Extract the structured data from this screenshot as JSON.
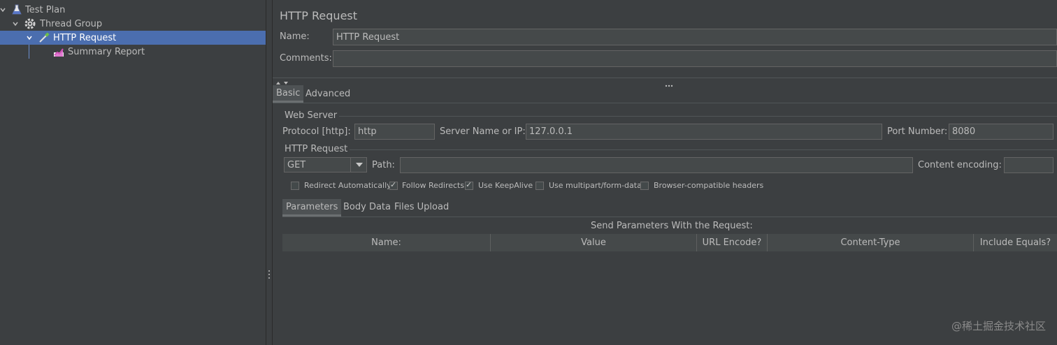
{
  "tree": {
    "items": [
      {
        "label": "Test Plan",
        "icon": "test-plan-flask-icon"
      },
      {
        "label": "Thread Group",
        "icon": "thread-group-gear-icon"
      },
      {
        "label": "HTTP Request",
        "icon": "http-request-pipette-icon",
        "selected": true
      },
      {
        "label": "Summary Report",
        "icon": "summary-report-chart-icon"
      }
    ]
  },
  "panel": {
    "title": "HTTP Request",
    "name_label": "Name:",
    "name_value": "HTTP Request",
    "comments_label": "Comments:",
    "comments_value": ""
  },
  "tabs": {
    "basic": "Basic",
    "advanced": "Advanced"
  },
  "web_server": {
    "section": "Web Server",
    "protocol_label": "Protocol [http]:",
    "protocol_value": "http",
    "server_label": "Server Name or IP:",
    "server_value": "127.0.0.1",
    "port_label": "Port Number:",
    "port_value": "8080"
  },
  "http_request": {
    "section": "HTTP Request",
    "method": "GET",
    "path_label": "Path:",
    "path_value": "",
    "encoding_label": "Content encoding:",
    "encoding_value": ""
  },
  "options": [
    {
      "label": "Redirect Automatically",
      "checked": false
    },
    {
      "label": "Follow Redirects",
      "checked": true
    },
    {
      "label": "Use KeepAlive",
      "checked": true
    },
    {
      "label": "Use multipart/form-data",
      "checked": false
    },
    {
      "label": "Browser-compatible headers",
      "checked": false
    }
  ],
  "sub_tabs": {
    "parameters": "Parameters",
    "body_data": "Body Data",
    "files_upload": "Files Upload"
  },
  "params_table": {
    "caption": "Send Parameters With the Request:",
    "columns": [
      "Name:",
      "Value",
      "URL Encode?",
      "Content-Type",
      "Include Equals?"
    ]
  },
  "watermark": "@稀土掘金技术社区",
  "colors": {
    "background": "#3c3f41",
    "selection": "#4b6eaf",
    "field": "#45494a"
  }
}
